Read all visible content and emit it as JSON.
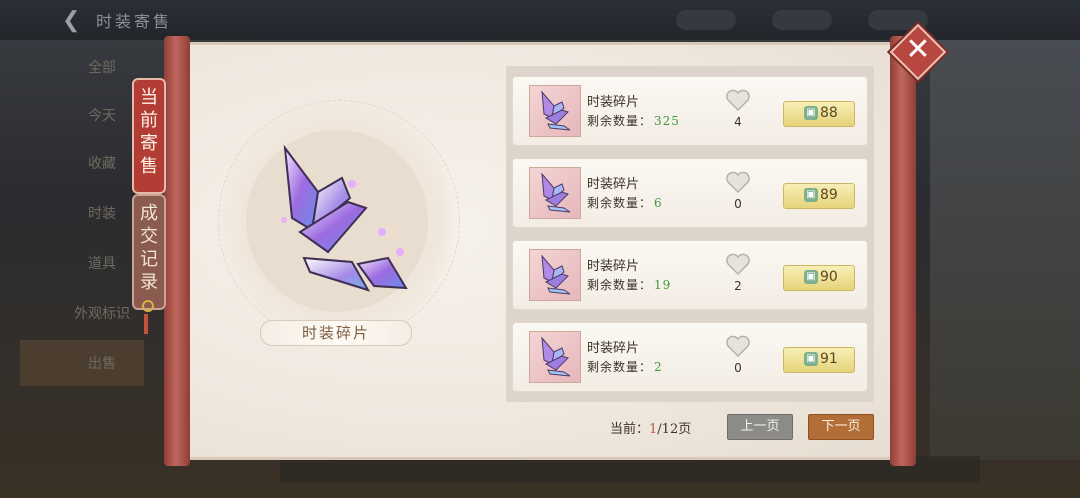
{
  "background": {
    "title": "时装寄售",
    "sidebar": [
      "全部",
      "今天",
      "收藏",
      "时装",
      "道具",
      "外观标识",
      "出售"
    ]
  },
  "tabs": [
    {
      "label": "当前寄售",
      "active": true
    },
    {
      "label": "成交记录",
      "active": false
    }
  ],
  "preview": {
    "item_name": "时装碎片"
  },
  "listings": [
    {
      "name": "时装碎片",
      "remain_label": "剩余数量：",
      "remain": "325",
      "likes": "4",
      "price": "88"
    },
    {
      "name": "时装碎片",
      "remain_label": "剩余数量：",
      "remain": "6",
      "likes": "0",
      "price": "89"
    },
    {
      "name": "时装碎片",
      "remain_label": "剩余数量：",
      "remain": "19",
      "likes": "2",
      "price": "90"
    },
    {
      "name": "时装碎片",
      "remain_label": "剩余数量：",
      "remain": "2",
      "likes": "0",
      "price": "91"
    }
  ],
  "pagination": {
    "label": "当前：",
    "current": "1",
    "total_suffix": "/12页",
    "prev_label": "上一页",
    "next_label": "下一页"
  },
  "icons": {
    "close": "close-icon",
    "heart": "heart-icon",
    "currency": "coin-icon",
    "back": "back-arrow-icon"
  },
  "colors": {
    "accent_red": "#b13d35",
    "price_gold": "#e6d47a",
    "remain_green": "#3c9a3a",
    "next_button": "#b26e36"
  }
}
